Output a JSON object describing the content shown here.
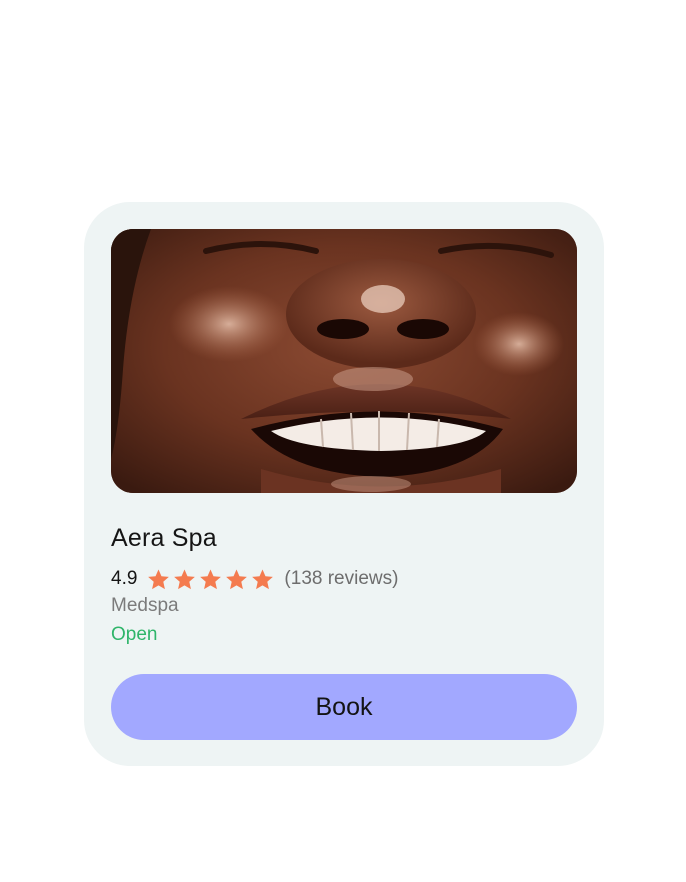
{
  "listing": {
    "title": "Aera Spa",
    "rating": "4.9",
    "stars": 5,
    "reviews": "(138 reviews)",
    "category": "Medspa",
    "status": "Open",
    "book_label": "Book"
  },
  "colors": {
    "card_bg": "#eef4f4",
    "star": "#f47b4f",
    "status_open": "#2fb56a",
    "button_bg": "#a2a8ff"
  },
  "icons": [
    "star-icon"
  ]
}
